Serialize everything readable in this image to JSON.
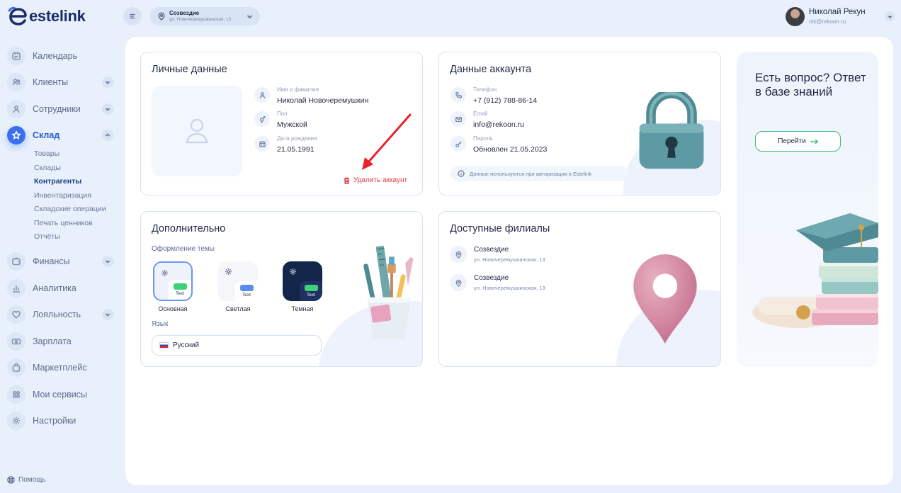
{
  "brand": {
    "name": "estelink",
    "accent": "#3b6ff0"
  },
  "sidebar": {
    "items": [
      {
        "label": "Календарь",
        "icon": "calendar-icon"
      },
      {
        "label": "Клиенты",
        "icon": "users-icon",
        "expandable": true
      },
      {
        "label": "Сотрудники",
        "icon": "user-icon",
        "expandable": true
      },
      {
        "label": "Склад",
        "icon": "warehouse-icon",
        "expandable": true,
        "active": true,
        "children": [
          "Товары",
          "Склады",
          "Контрагенты",
          "Инвентаризация",
          "Складские операции",
          "Печать ценников",
          "Отчёты"
        ],
        "active_child": "Контрагенты"
      },
      {
        "label": "Финансы",
        "icon": "wallet-icon",
        "expandable": true
      },
      {
        "label": "Аналитика",
        "icon": "chart-icon"
      },
      {
        "label": "Лояльность",
        "icon": "heart-icon",
        "expandable": true
      },
      {
        "label": "Зарплата",
        "icon": "money-icon"
      },
      {
        "label": "Маркетплейс",
        "icon": "bag-icon"
      },
      {
        "label": "Мои сервисы",
        "icon": "grid-icon"
      },
      {
        "label": "Настройки",
        "icon": "gear-icon"
      }
    ],
    "help_label": "Помощь"
  },
  "topbar": {
    "location_title": "Созвездие",
    "location_address": "ул. Новочеремушкинская, 13",
    "user_name": "Николай Рекун",
    "user_email": "nik@rekoon.ru"
  },
  "personal": {
    "title": "Личные данные",
    "fields": [
      {
        "label": "Имя и фамилия",
        "value": "Николай  Новочеремушкин",
        "icon": "user-icon"
      },
      {
        "label": "Пол",
        "value": "Мужской",
        "icon": "gender-icon"
      },
      {
        "label": "Дата рождения",
        "value": "21.05.1991",
        "icon": "calendar-icon"
      }
    ],
    "delete_label": "Удалить аккаунт"
  },
  "account": {
    "title": "Данные аккаунта",
    "fields": [
      {
        "label": "Телефон",
        "value": "+7 (912) 788-86-14",
        "icon": "phone-icon"
      },
      {
        "label": "Email",
        "value": "info@rekoon.ru",
        "icon": "mail-icon"
      },
      {
        "label": "Пароль",
        "value": "Обновлен 21.05.2023",
        "icon": "key-icon"
      }
    ],
    "notice": "Данные используются при авторизации в Estelink"
  },
  "extra": {
    "title": "Дополнительно",
    "theme_label": "Оформление темы",
    "chip_text": "Text",
    "themes": [
      {
        "name": "Основная",
        "selected": true
      },
      {
        "name": "Светлая",
        "selected": false
      },
      {
        "name": "Темная",
        "selected": false
      }
    ],
    "language_label": "Язык",
    "language_value": "Русский"
  },
  "branches": {
    "title": "Доступные филиалы",
    "items": [
      {
        "name": "Созвездие",
        "address": "ул. Новочеремушкинская, 13"
      },
      {
        "name": "Созвездие",
        "address": "ул. Новочеремушкинская, 13"
      }
    ]
  },
  "kb": {
    "title": "Есть вопрос? Ответ в базе знаний",
    "button_label": "Перейти"
  },
  "colors": {
    "danger": "#e03c4a",
    "success": "#3dbb7a",
    "dark_theme": "#14254a",
    "accent_green": "#3dd178",
    "accent_blue": "#5b8def"
  }
}
